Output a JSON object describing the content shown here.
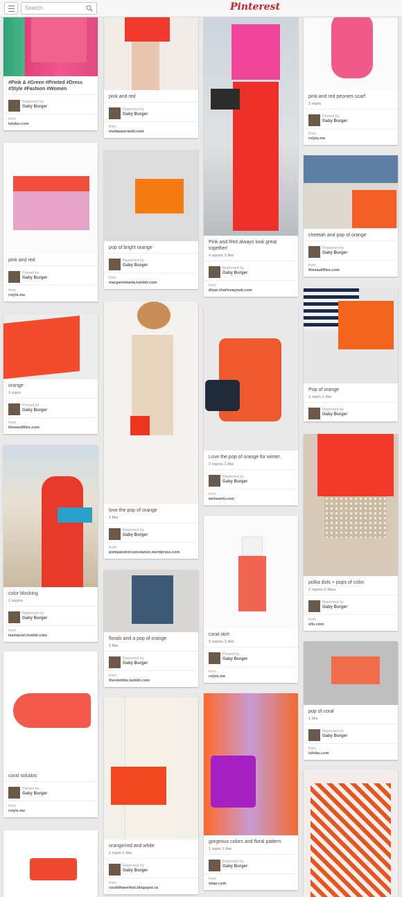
{
  "header": {
    "search_placeholder": "Search",
    "logo_text": "Pinterest",
    "brand_color": "#cb2027"
  },
  "labels": {
    "from": "from"
  },
  "pins": [
    {
      "desc": "#Pink & #Green #Printed #Dress #Style #Fashion #Women",
      "stats": "",
      "action": "Repinned by",
      "user": "Gaby Burger",
      "source": "lolobu.com"
    },
    {
      "desc": "pink and red",
      "stats": "",
      "action": "Pinned by",
      "user": "Gaby Burger",
      "source": "rstyle.me"
    },
    {
      "desc": "orange",
      "stats": "1 repin",
      "action": "Pinned by",
      "user": "Gaby Burger",
      "source": "thevaultfiles.com"
    },
    {
      "desc": "color blocking",
      "stats": "2 repins",
      "action": "Repinned by",
      "user": "Gaby Burger",
      "source": "lasmaciel.tumblr.com"
    },
    {
      "desc": "coral soludos",
      "stats": "",
      "action": "Pinned by",
      "user": "Gaby Burger",
      "source": "rstyle.me"
    },
    {
      "desc": "pink and red",
      "stats": "",
      "action": "Repinned by",
      "user": "Gaby Burger",
      "source": "modaoperandi.com"
    },
    {
      "desc": "pop of bright orange",
      "stats": "",
      "action": "Repinned by",
      "user": "Gaby Burger",
      "source": "margaretmaria.tumblr.com"
    },
    {
      "desc": "love the pop of orange",
      "stats": "1 like",
      "action": "Repinned by",
      "user": "Gaby Burger",
      "source": "pompandcircumstance.wordpress.com"
    },
    {
      "desc": "florals and a pop of orange",
      "stats": "1 like",
      "action": "Repinned by",
      "user": "Gaby Burger",
      "source": "thenletitbe.tumblr.com"
    },
    {
      "desc": "orange/red and white",
      "stats": "1 repin   1 like",
      "action": "Repinned by",
      "user": "Gaby Burger",
      "source": "couldihavethat.blogspot.ca"
    },
    {
      "desc": "Pink and Red always look great together!",
      "stats": "4 repins   1 like",
      "action": "Repinned by",
      "user": "Gaby Burger",
      "source": "diyar.charlesayoub.com"
    },
    {
      "desc": "Love the pop of orange for winter.",
      "stats": "3 repins   1 like",
      "action": "Repinned by",
      "user": "Gaby Burger",
      "source": "weheartit.com"
    },
    {
      "desc": "coral skirt",
      "stats": "2 repins   1 like",
      "action": "Pinned by",
      "user": "Gaby Burger",
      "source": "rstyle.me"
    },
    {
      "desc": "gorgeous colors and floral pattern",
      "stats": "1 repin   1 like",
      "action": "Repinned by",
      "user": "Gaby Burger",
      "source": "obaz.com"
    },
    {
      "desc": "pink and red peonies scarf",
      "stats": "1 repin",
      "action": "Pinned by",
      "user": "Gaby Burger",
      "source": "rstyle.me"
    },
    {
      "desc": "cheetah and pop of orange",
      "stats": "",
      "action": "Repinned by",
      "user": "Gaby Burger",
      "source": "thevaultfiles.com"
    },
    {
      "desc": "Pop of orange",
      "stats": "1 repin   1 like",
      "action": "Repinned by",
      "user": "Gaby Burger",
      "source": ""
    },
    {
      "desc": "polka dots + pops of color.",
      "stats": "2 repins   2 likes",
      "action": "Repinned by",
      "user": "Gaby Burger",
      "source": "elle.com"
    },
    {
      "desc": "pop of coral",
      "stats": "1 like",
      "action": "Repinned by",
      "user": "Gaby Burger",
      "source": "lolobu.com"
    }
  ]
}
